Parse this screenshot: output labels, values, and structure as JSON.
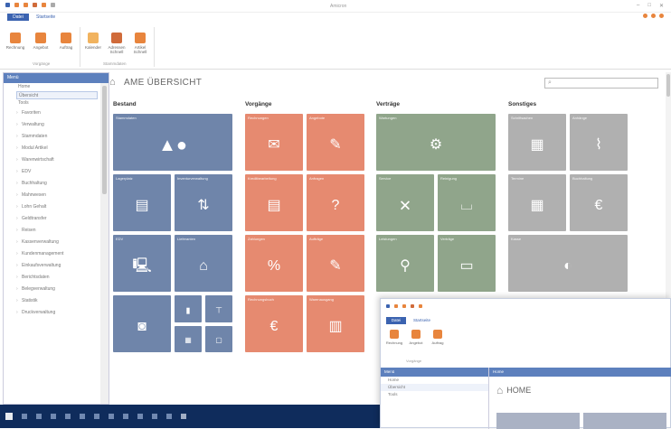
{
  "window": {
    "title": "Amicron"
  },
  "ribbon": {
    "file_tab": "Datei",
    "active_tab": "Startseite",
    "buttons": [
      "Rechnung",
      "Angebot",
      "Auftrag",
      "Kalender",
      "Adressen Schnell",
      "Artikel Schnell"
    ],
    "groups": [
      "Vorgänge",
      "Stammdaten"
    ]
  },
  "sidebar": {
    "header": "Menü",
    "items": [
      {
        "label": "Home",
        "sub": true
      },
      {
        "label": "Übersicht",
        "sub": true,
        "selected": true
      },
      {
        "label": "Tools",
        "sub": true
      },
      {
        "label": "Favoriten"
      },
      {
        "label": "Verwaltung"
      },
      {
        "label": "Stammdaten"
      },
      {
        "label": "Modul Artikel"
      },
      {
        "label": "Warenwirtschaft"
      },
      {
        "label": "EDV"
      },
      {
        "label": "Buchhaltung"
      },
      {
        "label": "Mahnwesen"
      },
      {
        "label": "Lohn Gehalt"
      },
      {
        "label": "Geldtransfer"
      },
      {
        "label": "Reisen"
      },
      {
        "label": "Kassenverwaltung"
      },
      {
        "label": "Kundenmanagement"
      },
      {
        "label": "Einkaufsverwaltung"
      },
      {
        "label": "Berichtsdaten"
      },
      {
        "label": "Belegverwaltung"
      },
      {
        "label": "Statistik"
      },
      {
        "label": "Druckverwaltung"
      }
    ]
  },
  "main": {
    "title": "AME ÜBERSICHT",
    "search_placeholder": "",
    "columns": [
      "Bestand",
      "Vorgänge",
      "Verträge",
      "Sonstiges"
    ],
    "tiles": {
      "bestand": [
        "Stammdaten",
        "Lagerplatz",
        "Inventurverwaltung",
        "EDV",
        "Lieferanten",
        "",
        "",
        "",
        ""
      ],
      "vorgaenge": [
        "Rechnungen",
        "Angebote",
        "Kreditbearbeitung",
        "Anfragen",
        "Zahlungen",
        "Aufträge",
        "Rechnungsbuch",
        "Warenausgang"
      ],
      "vertraege": [
        "Wartungen",
        "Service",
        "Reinigung",
        "Leistungen",
        "Verträge"
      ],
      "sonstiges": [
        "Schriftsachen",
        "Anhänge",
        "Termine",
        "Buchhaltung",
        "Kasse"
      ]
    }
  },
  "second_window": {
    "file_tab": "Datei",
    "active_tab": "Startseite",
    "buttons": [
      "Rechnung",
      "Angebot",
      "Auftrag"
    ],
    "group": "Vorgänge",
    "sidebar_header": "Menü",
    "sidebar_items": [
      "Home",
      "Übersicht",
      "Tools"
    ],
    "main_header": "Home",
    "home_title": "HOME"
  },
  "colors": {
    "blue": "#6f85aa",
    "orange": "#e68a70",
    "green": "#90a58b",
    "gray": "#b0b0b0",
    "accent": "#3b63b0"
  }
}
